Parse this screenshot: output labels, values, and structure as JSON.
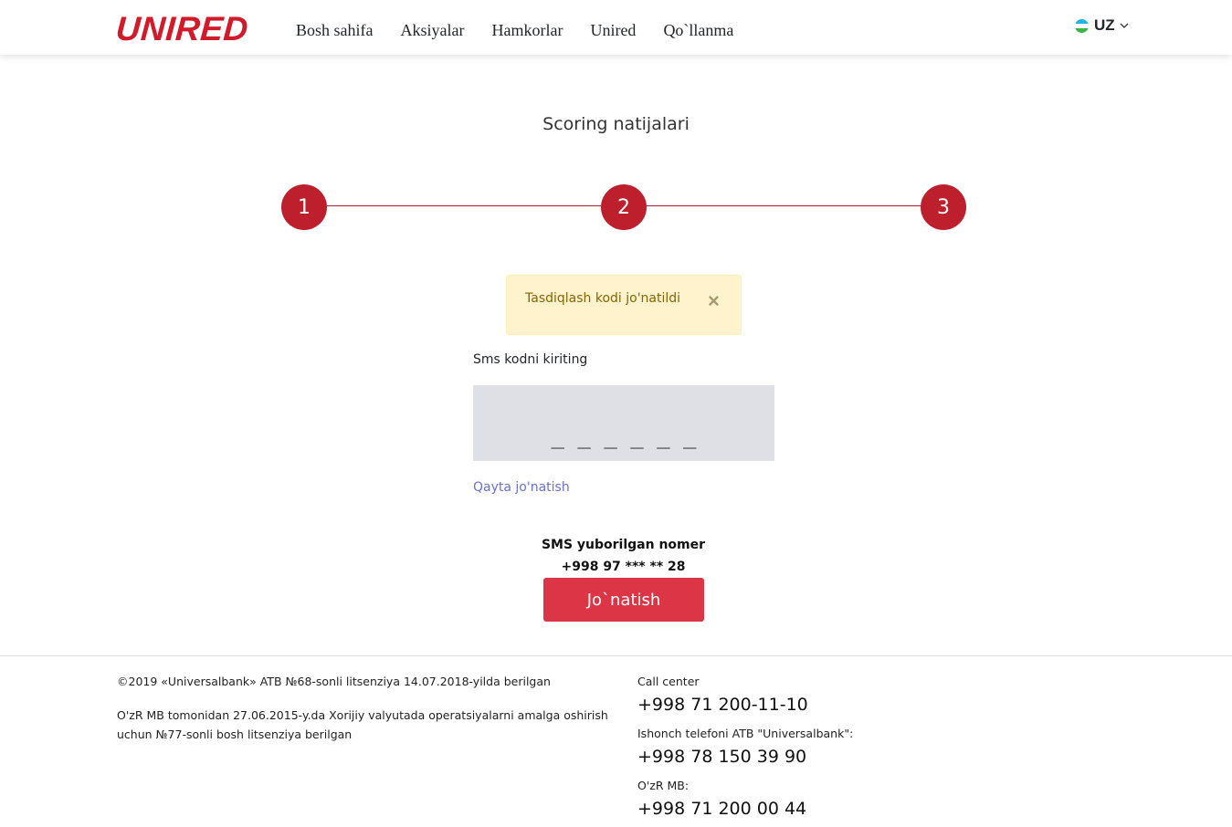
{
  "header": {
    "logo": "UNIRED",
    "nav": [
      "Bosh sahifa",
      "Aksiyalar",
      "Hamkorlar",
      "Unired",
      "Qo`llanma"
    ],
    "language": "UZ"
  },
  "page_title": "Scoring natijalari",
  "steps": [
    "1",
    "2",
    "3"
  ],
  "alert": {
    "message": "Tasdiqlash kodi jo'natildi",
    "close": "×"
  },
  "sms_form": {
    "label": "Sms kodni kiriting",
    "placeholder": "_ _ _ _ _ _",
    "value": "",
    "resend": "Qayta jo'natish",
    "sent_to_label": "SMS yuborilgan nomer",
    "sent_to_number": "+998 97 *** ** 28",
    "submit": "Jo`natish"
  },
  "footer": {
    "license1": "©2019 «Universalbank» ATB №68-sonli litsenziya 14.07.2018-yilda berilgan",
    "license2_line1": "O'zR MB tomonidan 27.06.2015-y.da Xorijiy valyutada operatsiyalarni amalga oshirish",
    "license2_line2": "uchun №77-sonli bosh litsenziya berilgan",
    "call_center_label": "Call center",
    "call_center_phone": "+998 71 200-11-10",
    "trust_label": "Ishonch telefoni ATB \"Universalbank\":",
    "trust_phone": "+998 78 150 39 90",
    "cbu_label": "O'zR MB:",
    "cbu_phone": "+998 71 200 00 44"
  },
  "colors": {
    "brand": "#d11a2a",
    "step": "#bd1f2d",
    "button": "#dc3545",
    "alert_bg": "#fff3cd",
    "link": "#6a6fd4"
  }
}
